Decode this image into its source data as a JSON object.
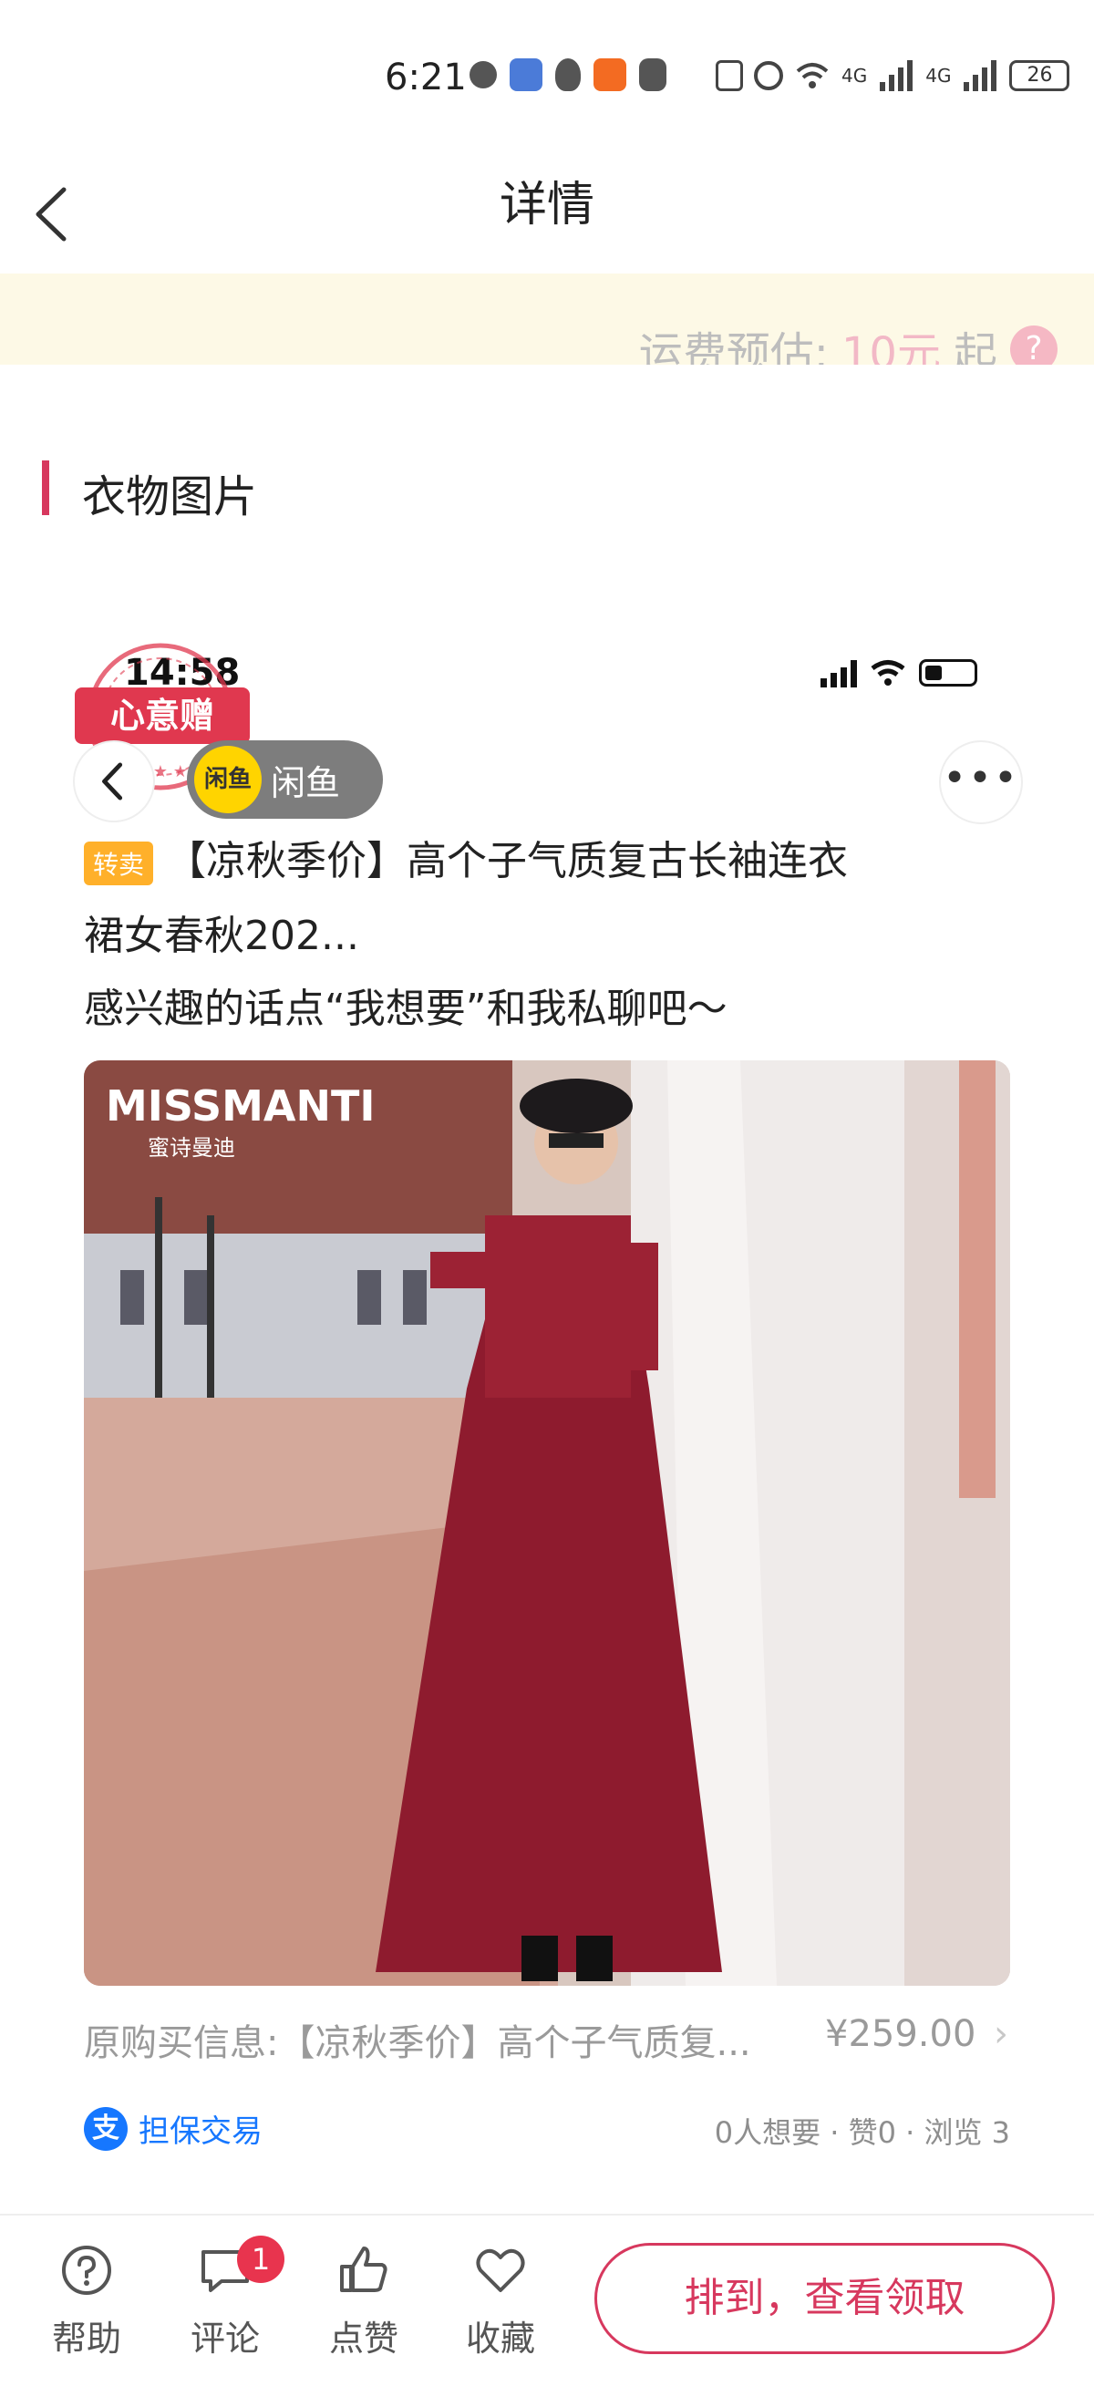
{
  "status_bar": {
    "time": "6:21",
    "net_1": "4G",
    "net_2": "4G",
    "battery": "26"
  },
  "header": {
    "title": "详情"
  },
  "shipping": {
    "label": "运费预估:",
    "price": "10元",
    "suffix": "起",
    "help": "?"
  },
  "section": {
    "title": "衣物图片"
  },
  "embedded": {
    "time": "14:58",
    "stamp": "心意赠",
    "app_logo": "闲鱼",
    "app_name": "闲鱼",
    "more": "•••",
    "tag": "转卖",
    "title_line1": "【凉秋季价】高个子气质复古长袖连衣",
    "title_line2": "裙女春秋202...",
    "invite": "感兴趣的话点“我想要”和我私聊吧～",
    "brand": "MISSMANTI",
    "brand_cn": "蜜诗曼迪",
    "orig_info": "原购买信息:【凉秋季价】高个子气质复...",
    "orig_price": "¥259.00",
    "chevron": "›",
    "escrow": "担保交易",
    "escrow_icon": "支",
    "stats": "0人想要 · 赞0 · 浏览 3"
  },
  "bottom": {
    "help": "帮助",
    "comment": "评论",
    "comment_badge": "1",
    "like": "点赞",
    "favorite": "收藏",
    "claim": "排到，查看领取"
  },
  "colors": {
    "accent": "#d7385e",
    "banner_bg": "#fdf9e6",
    "dress": "#8e1b2e"
  }
}
